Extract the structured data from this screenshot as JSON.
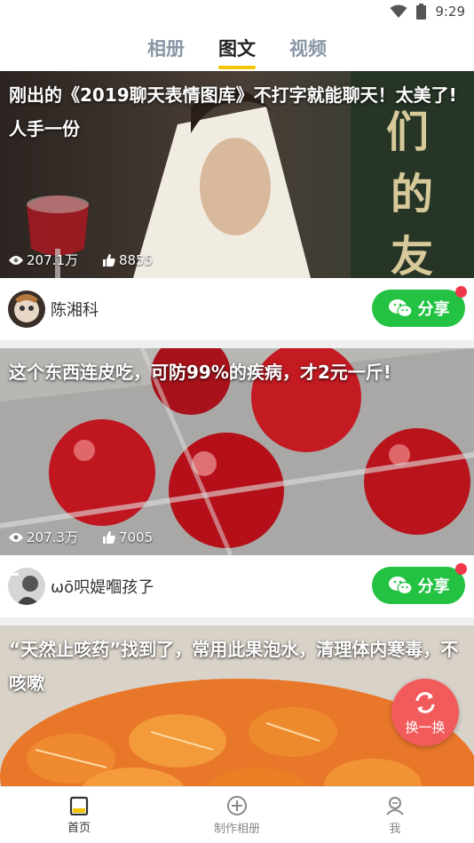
{
  "status": {
    "time": "9:29"
  },
  "tabs": [
    {
      "label": "相册",
      "active": false
    },
    {
      "label": "图文",
      "active": true
    },
    {
      "label": "视频",
      "active": false
    }
  ],
  "cards": [
    {
      "title": "刚出的《2019聊天表情图库》不打字就能聊天！太美了! 人手一份",
      "views": "207.1万",
      "likes": "8855",
      "author": "陈湘科",
      "share_label": "分享",
      "overlay_text": "们的友"
    },
    {
      "title": "这个东西连皮吃，可防99%的疾病，才2元一斤!",
      "views": "207.3万",
      "likes": "7005",
      "author": "ωō呮媞嗰孩孒",
      "share_label": "分享"
    },
    {
      "title": "“天然止咳药”找到了，常用此果泡水，清理体内寒毒，不咳嗽"
    }
  ],
  "fab": {
    "label": "换一换"
  },
  "bottom_nav": [
    {
      "label": "首页",
      "icon": "home-icon",
      "active": true
    },
    {
      "label": "制作相册",
      "icon": "plus-circle-icon",
      "active": false
    },
    {
      "label": "我",
      "icon": "user-icon",
      "active": false
    }
  ],
  "colors": {
    "accent": "#f5c400",
    "share_green": "#23c243",
    "fab_red": "#f25b5b",
    "dot_red": "#f0384a"
  }
}
